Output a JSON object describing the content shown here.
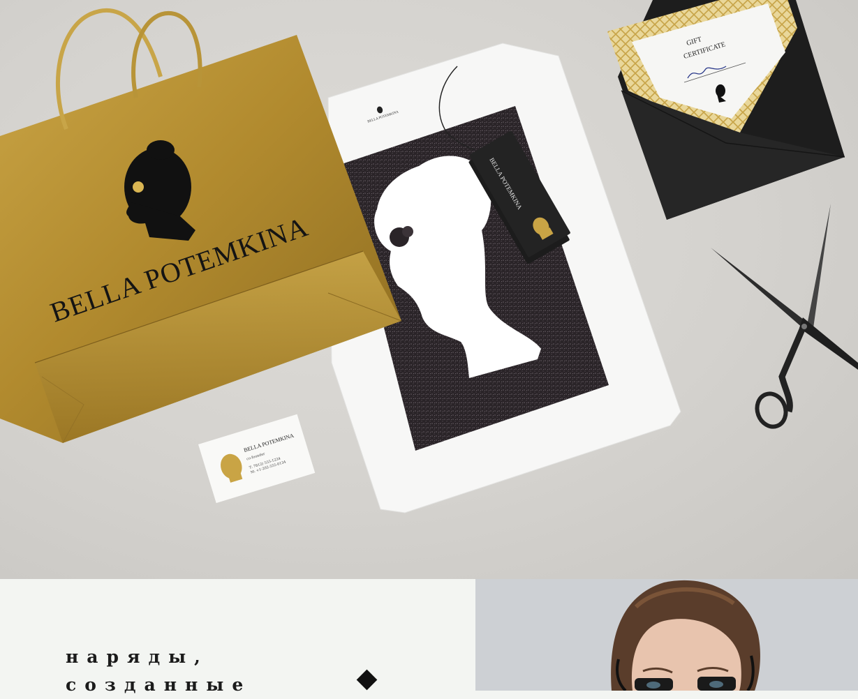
{
  "bag": {
    "brand": "BELLA POTEMKINA"
  },
  "shirt": {
    "label": "BELLA POTEMKINA"
  },
  "hang_tag": {
    "brand": "BELLA POTEMKINA"
  },
  "certificate": {
    "line1": "GIFT",
    "line2": "CERTIFICATE"
  },
  "business_card": {
    "brand": "BELLA POTEMKINA",
    "role": "co-founder",
    "phone_t": "T: 7812) 555-1234",
    "phone_m": "M: +1-202-555-0134"
  },
  "tagline": {
    "line1": "наряды,",
    "line2": "созданные"
  },
  "colors": {
    "gold": "#b8922f",
    "black": "#111111",
    "background": "#f3f5f2"
  }
}
